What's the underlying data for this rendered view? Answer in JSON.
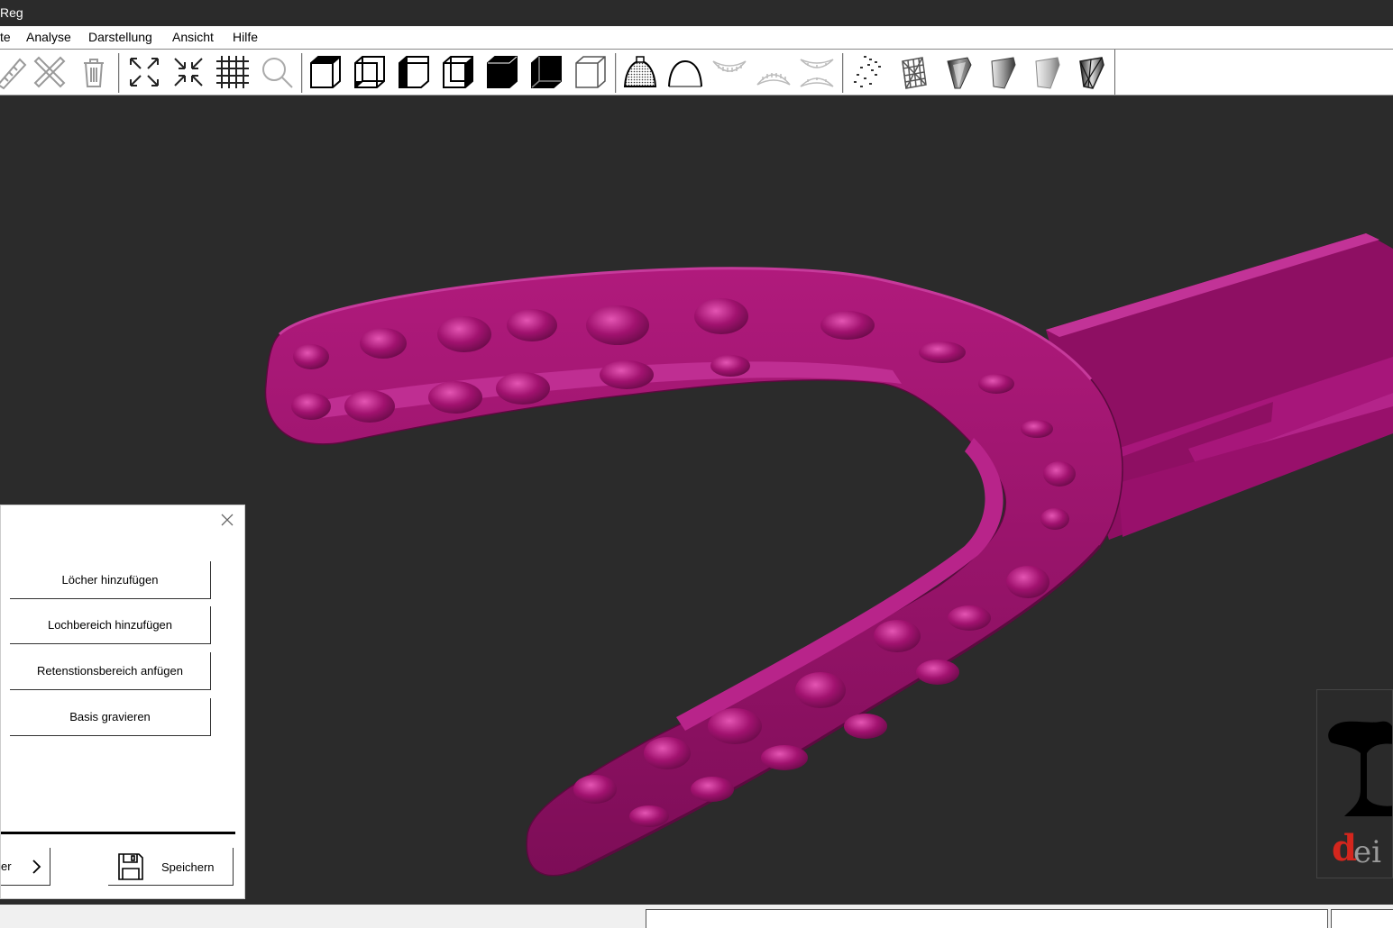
{
  "window": {
    "title": "Reg"
  },
  "menu": {
    "items": [
      "te",
      "Analyse",
      "Darstellung",
      "Ansicht",
      "Hilfe"
    ]
  },
  "toolbar": {
    "icons": [
      "ruler-icon",
      "ruler-cross-icon",
      "trash-icon",
      "expand-icon",
      "shrink-icon",
      "grid-icon",
      "zoom-icon",
      "view-front-icon",
      "view-back-icon",
      "view-left-icon",
      "view-right-icon",
      "view-top-icon",
      "view-bottom-icon",
      "view-iso-icon",
      "tray-dotted-icon",
      "tray-outline-icon",
      "teeth-upper-icon",
      "teeth-lower-icon",
      "teeth-both-icon",
      "points-icon",
      "mesh-wire-icon",
      "shade-flat-icon",
      "shade-smooth-icon",
      "shade-gouraud-icon",
      "shade-mixed-icon"
    ]
  },
  "model": {
    "color": "#a1126f",
    "highlight": "#d43aa2",
    "shadow": "#6a0b49"
  },
  "logo": {
    "first_letter": "d",
    "rest": "ei e"
  },
  "panel": {
    "buttons": [
      "Löcher hinzufügen",
      "Lochbereich hinzufügen",
      "Retenstionsbereich anfügen",
      "Basis gravieren"
    ],
    "nav_label": "er",
    "save_label": "Speichern"
  }
}
